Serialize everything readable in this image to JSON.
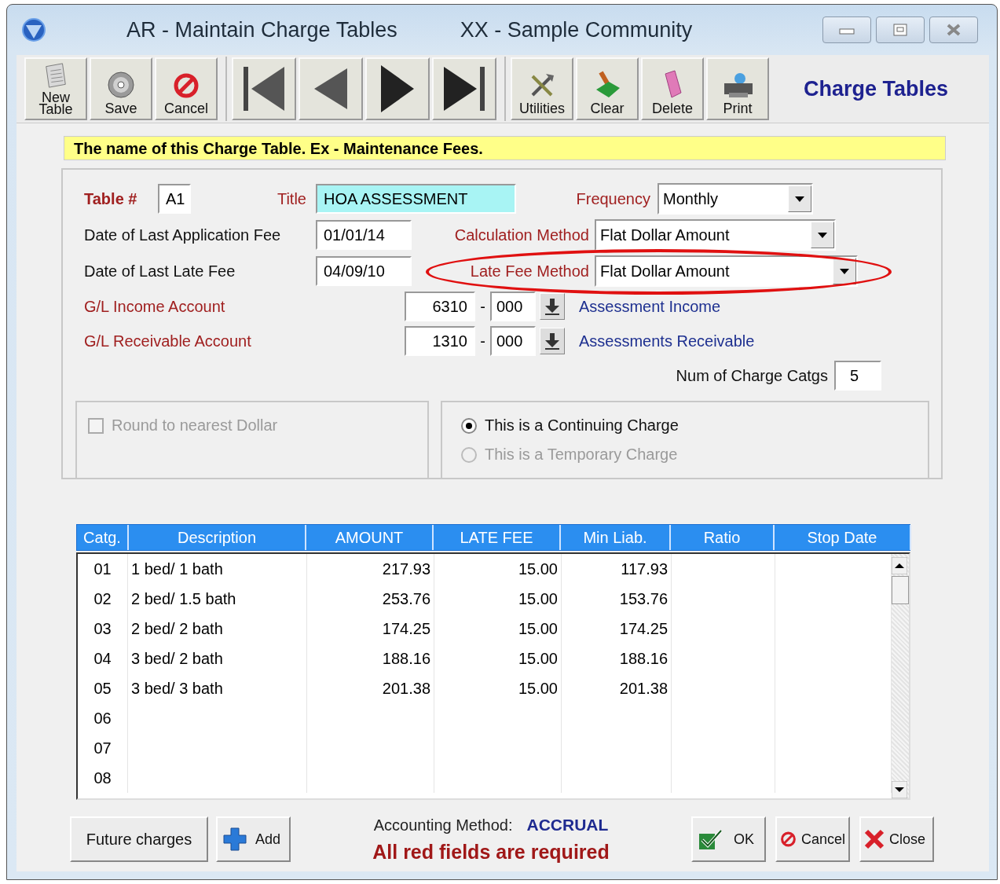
{
  "window": {
    "title": "AR - Maintain Charge Tables",
    "subtitle": "XX  - Sample Community"
  },
  "toolbar": [
    [
      {
        "kind": "new",
        "label": "New Table"
      },
      {
        "kind": "save",
        "label": "Save"
      },
      {
        "kind": "cancel",
        "label": "Cancel"
      }
    ],
    [
      {
        "kind": "first"
      },
      {
        "kind": "prev"
      },
      {
        "kind": "next"
      },
      {
        "kind": "last"
      }
    ],
    [
      {
        "kind": "utilities",
        "label": "Utilities"
      },
      {
        "kind": "clear",
        "label": "Clear"
      },
      {
        "kind": "delete",
        "label": "Delete"
      },
      {
        "kind": "print",
        "label": "Print"
      }
    ]
  ],
  "module_title": "Charge Tables",
  "hint": "The name of this Charge Table.  Ex - Maintenance Fees.",
  "form": {
    "table_no": {
      "label": "Table #",
      "value": "A1",
      "required": true
    },
    "title": {
      "label": "Title",
      "value": "HOA ASSESSMENT",
      "required": true
    },
    "frequency": {
      "label": "Frequency",
      "value": "Monthly",
      "required": true
    },
    "last_application_fee": {
      "label": "Date of Last Application Fee",
      "value": "01/01/14",
      "required": false
    },
    "calculation_method": {
      "label": "Calculation Method",
      "value": "Flat Dollar Amount",
      "required": true,
      "circled": false
    },
    "last_late_fee": {
      "label": "Date of Last Late Fee",
      "value": "04/09/10",
      "required": false
    },
    "late_fee_method": {
      "label": "Late Fee Method",
      "value": "Flat Dollar Amount",
      "required": true,
      "circled": true
    },
    "gl_accounts": [
      {
        "label": "G/L Income Account",
        "account": "6310",
        "separator": "-",
        "sub": "000",
        "name": "Assessment Income",
        "required": true
      },
      {
        "label": "G/L Receivable Account",
        "account": "1310",
        "separator": "-",
        "sub": "000",
        "name": "Assessments Receivable",
        "required": true
      }
    ],
    "num_catgs": {
      "label": "Num of Charge Catgs",
      "value": "5"
    },
    "round": {
      "label": "Round to nearest Dollar",
      "checked": false,
      "disabled": true
    },
    "charge_type": [
      {
        "label": "This is a Continuing Charge",
        "selected": true,
        "disabled": false
      },
      {
        "label": "This is a Temporary Charge",
        "selected": false,
        "disabled": true
      }
    ]
  },
  "table": {
    "columns": [
      "Catg.",
      "Description",
      "AMOUNT",
      "LATE FEE",
      "Min Liab.",
      "Ratio",
      "Stop Date"
    ],
    "rows": [
      {
        "catg": "01",
        "description": "1 bed/ 1 bath",
        "amount": "217.93",
        "late_fee": "15.00",
        "min_liab": "117.93"
      },
      {
        "catg": "02",
        "description": "2 bed/ 1.5 bath",
        "amount": "253.76",
        "late_fee": "15.00",
        "min_liab": "153.76"
      },
      {
        "catg": "03",
        "description": "2 bed/ 2 bath",
        "amount": "174.25",
        "late_fee": "15.00",
        "min_liab": "174.25"
      },
      {
        "catg": "04",
        "description": "3 bed/ 2 bath",
        "amount": "188.16",
        "late_fee": "15.00",
        "min_liab": "188.16"
      },
      {
        "catg": "05",
        "description": "3 bed/ 3 bath",
        "amount": "201.38",
        "late_fee": "15.00",
        "min_liab": "201.38"
      },
      {
        "catg": "06"
      },
      {
        "catg": "07"
      },
      {
        "catg": "08"
      }
    ]
  },
  "footer": {
    "future_charges": "Future charges",
    "add": "Add",
    "accounting": {
      "label": "Accounting Method:",
      "value": "ACCRUAL"
    },
    "required_note": "All red fields are required",
    "buttons": [
      {
        "kind": "ok",
        "label": "OK"
      },
      {
        "kind": "cancel",
        "label": "Cancel"
      },
      {
        "kind": "close",
        "label": "Close"
      }
    ]
  }
}
